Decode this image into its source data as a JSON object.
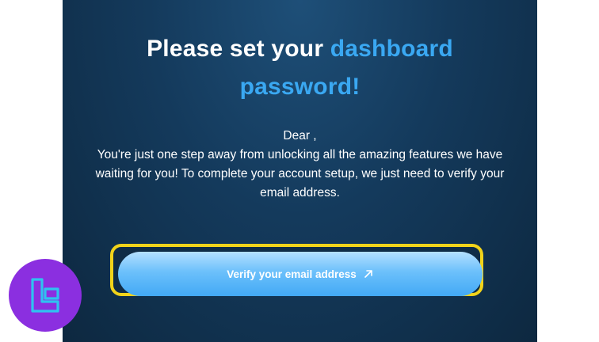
{
  "email": {
    "headline_part1": "Please set your ",
    "headline_accent1": "dashboard",
    "headline_accent2": "password!",
    "greeting": "Dear ,",
    "message": "You're just one step away from unlocking all the amazing features we have waiting for you! To complete your account setup, we just need to verify your email address.",
    "verify_button_label": "Verify your email address",
    "verify_button_icon": "arrow-up-right-icon"
  },
  "branding": {
    "logo_icon": "tc-logo-icon"
  },
  "colors": {
    "card_background": "#143a5c",
    "accent": "#3aa8f2",
    "button": "#5cb8f8",
    "highlight_frame": "#f1d31a",
    "logo_background": "#8b2fe0",
    "logo_stroke": "#2fc2f0"
  }
}
